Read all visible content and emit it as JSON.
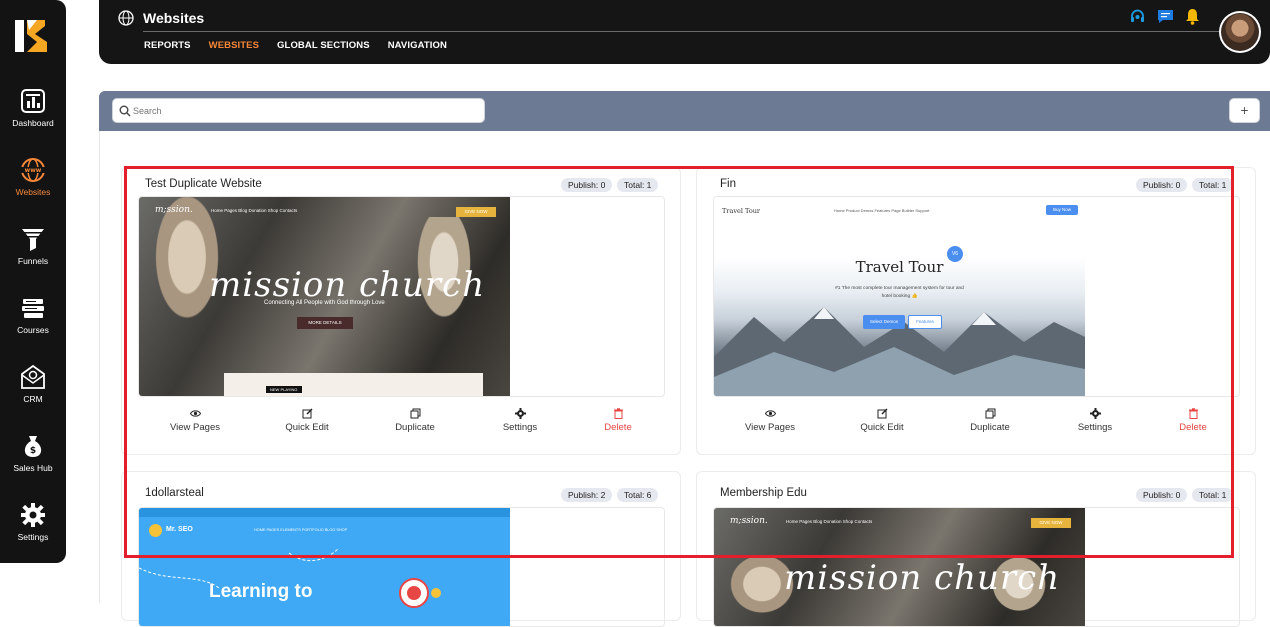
{
  "sidebar": {
    "items": [
      {
        "label": "Dashboard",
        "icon": "dashboard-icon",
        "active": false
      },
      {
        "label": "Websites",
        "icon": "globe-www-icon",
        "active": true
      },
      {
        "label": "Funnels",
        "icon": "funnel-icon",
        "active": false
      },
      {
        "label": "Courses",
        "icon": "books-icon",
        "active": false
      },
      {
        "label": "CRM",
        "icon": "crm-envelope-icon",
        "active": false
      },
      {
        "label": "Sales Hub",
        "icon": "money-bag-icon",
        "active": false
      },
      {
        "label": "Settings",
        "icon": "gear-icon",
        "active": false
      }
    ]
  },
  "header": {
    "title": "Websites",
    "tabs": [
      {
        "label": "REPORTS",
        "active": false
      },
      {
        "label": "WEBSITES",
        "active": true
      },
      {
        "label": "GLOBAL SECTIONS",
        "active": false
      },
      {
        "label": "NAVIGATION",
        "active": false
      }
    ],
    "icons": [
      "headset-icon",
      "chat-icon",
      "bell-icon"
    ]
  },
  "search": {
    "placeholder": "Search",
    "value": ""
  },
  "add_button": {
    "label": "+"
  },
  "colors": {
    "accent": "#f5873a",
    "sidebar": "#131313",
    "band": "#6c7a93",
    "delete": "#e84545",
    "highlight": "#e41e2b",
    "notif": "#1e7be0",
    "bell": "#f5b800"
  },
  "actions": {
    "view": "View Pages",
    "edit": "Quick Edit",
    "duplicate": "Duplicate",
    "settings": "Settings",
    "delete": "Delete"
  },
  "cards": [
    {
      "name": "Test Duplicate Website",
      "publish": "Publish: 0",
      "total": "Total: 1",
      "thumb": {
        "title": "mission church",
        "tagline": "Connecting All People with God through Love",
        "button": "MORE DETAILS",
        "cta": "GIVE NOW",
        "nav": "Home  Pages  Blog  Donation  Shop  Contacts",
        "footer_tag": "NEW PLAYING"
      }
    },
    {
      "name": "Fin",
      "publish": "Publish: 0",
      "total": "Total: 1",
      "thumb": {
        "brand": "Travel Tour",
        "title": "Travel Tour",
        "tagline": "#1 The most complete tour management system for tour and hotel booking 👍",
        "button1": "Select Demos",
        "button2": "Features",
        "cta": "Buy Now",
        "badge": "V6",
        "nav": "Home  Product Demos  Features  Page Builder  Support"
      }
    },
    {
      "name": "1dollarsteal",
      "publish": "Publish: 2",
      "total": "Total: 6",
      "thumb": {
        "brand": "Mr. SEO",
        "title": "Learning to",
        "nav": "HOME  PAGES  ELEMENTS  PORTFOLIO  BLOG  SHOP"
      }
    },
    {
      "name": "Membership Edu",
      "publish": "Publish: 0",
      "total": "Total: 1",
      "thumb": {
        "title": "mission church",
        "cta": "GIVE NOW",
        "nav": "Home  Pages  Blog  Donation  Shop  Contacts"
      }
    }
  ]
}
